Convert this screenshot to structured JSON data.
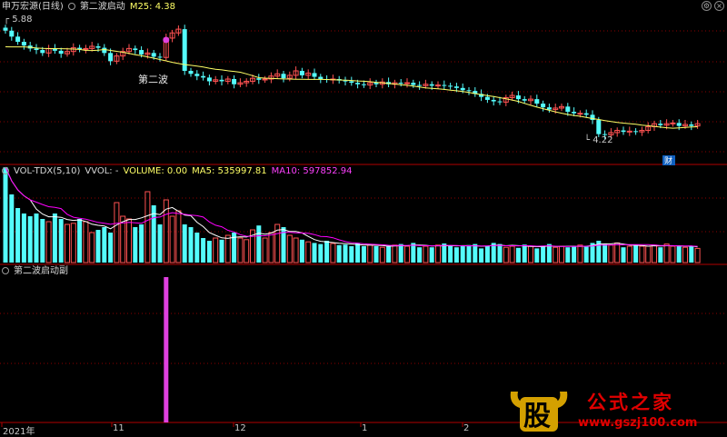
{
  "main_header": {
    "stock": "申万宏源(日线)",
    "indicator": "第二波启动",
    "ma_label": "M25: 4.38"
  },
  "vol_header": {
    "name": "VOL-TDX(5,10)",
    "vvol": "VVOL: -",
    "volume": "VOLUME: 0.00",
    "ma5": "MA5: 535997.81",
    "ma10": "MA10: 597852.94"
  },
  "sub_header": {
    "name": "第二波启动副"
  },
  "colors": {
    "up": "#ff5252",
    "down": "#54fcfc",
    "ma25": "#ffff66",
    "ma5": "#ffffff",
    "ma10": "#ff00ff",
    "signal": "#e040e0",
    "grid": "#8b0000",
    "frame": "#b00000"
  },
  "chart_data": [
    {
      "type": "candlestick",
      "title": "申万宏源(日线)",
      "y_high_label": "5.88",
      "y_low_label": "4.22",
      "annotation": "第二波",
      "marker": "财",
      "series": [
        {
          "name": "M25",
          "last_value": 4.38
        }
      ],
      "close": [
        5.7,
        5.62,
        5.55,
        5.5,
        5.46,
        5.44,
        5.4,
        5.46,
        5.43,
        5.39,
        5.42,
        5.47,
        5.45,
        5.46,
        5.49,
        5.47,
        5.4,
        5.29,
        5.36,
        5.42,
        5.46,
        5.44,
        5.38,
        5.4,
        5.35,
        5.34,
        5.6,
        5.67,
        5.72,
        5.16,
        5.12,
        5.09,
        5.07,
        5.02,
        5.04,
        5.02,
        5.05,
        4.98,
        5.0,
        5.02,
        5.06,
        5.04,
        5.05,
        5.09,
        5.12,
        5.06,
        5.1,
        5.16,
        5.1,
        5.13,
        5.08,
        5.05,
        5.04,
        5.05,
        5.03,
        5.02,
        5.0,
        4.98,
        4.97,
        5.0,
        4.98,
        5.01,
        4.98,
        5.0,
        4.99,
        5.0,
        4.97,
        4.96,
        4.98,
        4.96,
        4.97,
        4.96,
        4.95,
        4.93,
        4.9,
        4.89,
        4.85,
        4.81,
        4.77,
        4.75,
        4.74,
        4.8,
        4.83,
        4.78,
        4.76,
        4.78,
        4.72,
        4.67,
        4.64,
        4.66,
        4.68,
        4.61,
        4.59,
        4.59,
        4.57,
        4.5,
        4.31,
        4.3,
        4.33,
        4.36,
        4.34,
        4.35,
        4.34,
        4.36,
        4.41,
        4.45,
        4.43,
        4.45,
        4.46,
        4.42,
        4.44,
        4.42,
        4.45
      ]
    },
    {
      "type": "bar",
      "title": "VOL-TDX(5,10)",
      "series": [
        {
          "name": "MA5",
          "last_value": 535997.81
        },
        {
          "name": "MA10",
          "last_value": 597852.94
        }
      ],
      "values": [
        1.75,
        1.25,
        1.0,
        0.9,
        0.85,
        0.9,
        0.8,
        0.75,
        0.9,
        0.8,
        0.7,
        0.72,
        0.8,
        0.75,
        0.55,
        0.6,
        0.65,
        0.55,
        1.1,
        0.85,
        0.8,
        0.65,
        0.7,
        1.3,
        1.05,
        0.7,
        1.15,
        0.85,
        0.95,
        0.7,
        0.65,
        0.55,
        0.45,
        0.4,
        0.45,
        0.42,
        0.5,
        0.55,
        0.45,
        0.42,
        0.6,
        0.68,
        0.45,
        0.55,
        0.7,
        0.65,
        0.5,
        0.45,
        0.42,
        0.38,
        0.36,
        0.34,
        0.4,
        0.35,
        0.32,
        0.33,
        0.3,
        0.36,
        0.3,
        0.32,
        0.3,
        0.28,
        0.3,
        0.32,
        0.34,
        0.3,
        0.36,
        0.28,
        0.3,
        0.28,
        0.32,
        0.35,
        0.3,
        0.28,
        0.3,
        0.32,
        0.34,
        0.26,
        0.3,
        0.36,
        0.34,
        0.28,
        0.3,
        0.27,
        0.33,
        0.3,
        0.26,
        0.3,
        0.34,
        0.28,
        0.3,
        0.28,
        0.3,
        0.32,
        0.3,
        0.36,
        0.4,
        0.34,
        0.32,
        0.36,
        0.28,
        0.3,
        0.32,
        0.3,
        0.3,
        0.32,
        0.28,
        0.34,
        0.3,
        0.3,
        0.28,
        0.3,
        0.26
      ]
    },
    {
      "type": "bar",
      "title": "第二波启动副",
      "signal_index": 26,
      "signal_value": 1
    }
  ],
  "x_axis": [
    "2021年",
    "11",
    "12",
    "1",
    "2"
  ],
  "watermark": {
    "logo_char": "股",
    "name": "公式之家",
    "url": "www.gszj100.com"
  }
}
